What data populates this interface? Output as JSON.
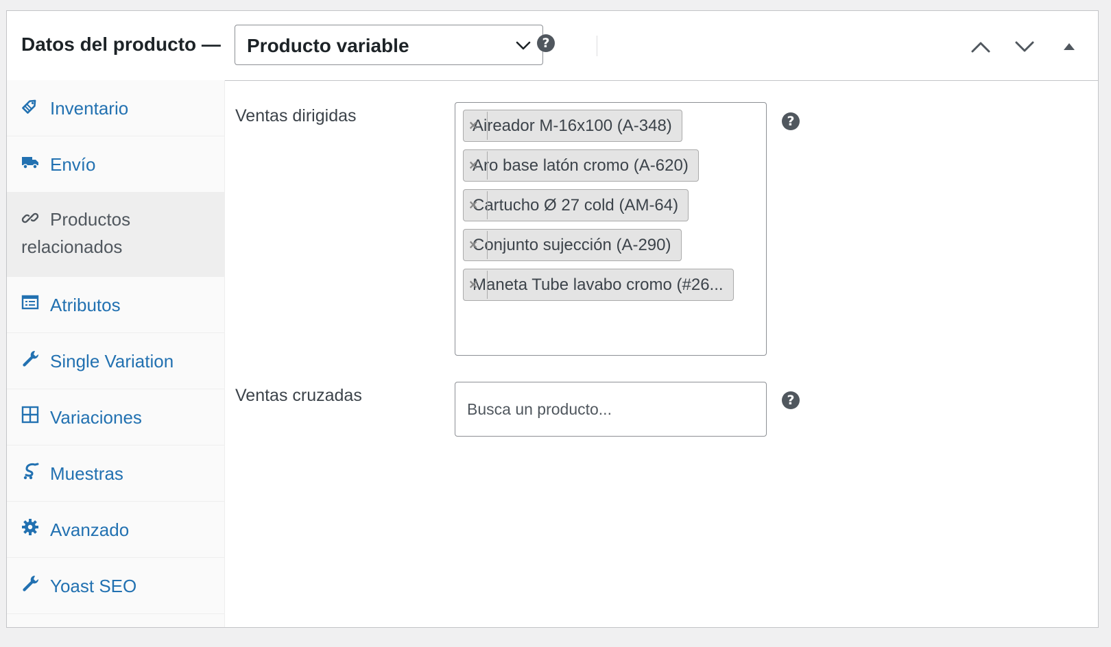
{
  "header": {
    "title": "Datos del producto —",
    "product_type": "Producto variable",
    "help_glyph": "?"
  },
  "sidebar": {
    "items": [
      {
        "label": "Inventario",
        "icon": "tag-icon"
      },
      {
        "label": "Envío",
        "icon": "truck-icon"
      },
      {
        "label": "Productos relacionados",
        "icon": "link-icon",
        "active": true
      },
      {
        "label": "Atributos",
        "icon": "list-table-icon"
      },
      {
        "label": "Single Variation",
        "icon": "wrench-icon"
      },
      {
        "label": "Variaciones",
        "icon": "grid-icon"
      },
      {
        "label": "Muestras",
        "icon": "samples-icon"
      },
      {
        "label": "Avanzado",
        "icon": "gear-icon"
      },
      {
        "label": "Yoast SEO",
        "icon": "wrench-icon"
      }
    ]
  },
  "main": {
    "upsells": {
      "label": "Ventas dirigidas",
      "selected": [
        "Aireador M-16x100 (A-348)",
        "Aro base latón cromo (A-620)",
        "Cartucho Ø 27 cold (AM-64)",
        "Conjunto sujección (A-290)",
        "Maneta Tube lavabo cromo (#26..."
      ],
      "remove_glyph": "×"
    },
    "crosssells": {
      "label": "Ventas cruzadas",
      "placeholder": "Busca un producto..."
    }
  },
  "colors": {
    "link": "#2271b1",
    "active_text": "#50575e",
    "chip_bg": "#e4e4e4",
    "border": "#8c8f94"
  }
}
